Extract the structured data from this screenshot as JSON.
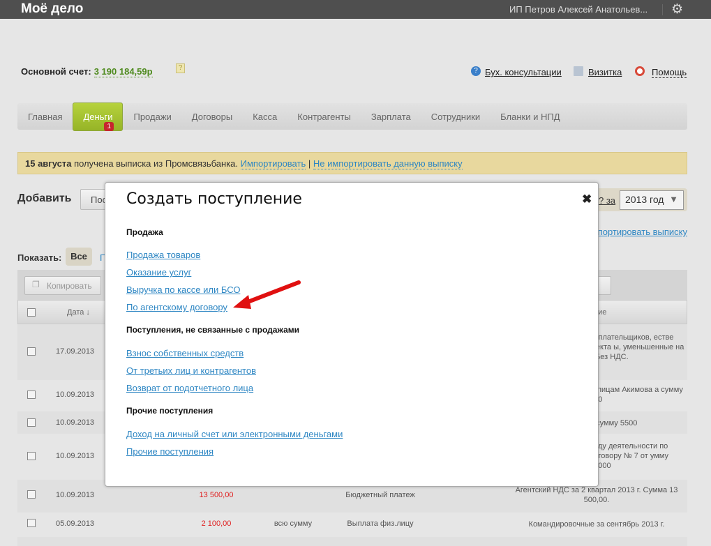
{
  "header": {
    "logo": "Моё дело",
    "user": "ИП Петров Алексей Анатольев...",
    "settings_icon": "gear-icon"
  },
  "account": {
    "label": "Основной счет:",
    "value": "3 190 184,59р",
    "help": "?"
  },
  "top_links": [
    {
      "label": "Бух. консультации",
      "icon": "question-icon"
    },
    {
      "label": "Визитка",
      "icon": "card-icon"
    },
    {
      "label": "Помощь",
      "icon": "lifebuoy-icon"
    }
  ],
  "nav": {
    "tabs": [
      "Главная",
      "Деньги",
      "Продажи",
      "Договоры",
      "Касса",
      "Контрагенты",
      "Зарплата",
      "Сотрудники",
      "Бланки и НПД"
    ],
    "active": "Деньги",
    "badge": "1"
  },
  "notice": {
    "date": "15 августа",
    "text": " получена выписка из Промсвязьбанка. ",
    "import": "Импортировать",
    "sep": " | ",
    "skip": "Не импортировать данную выписку"
  },
  "toolbar": {
    "add_label": "Добавить",
    "add_button": "Пос",
    "period_link": "? за",
    "year": "2013 год",
    "import_link": "Импортировать выписку"
  },
  "filter": {
    "label": "Показать:",
    "all": "Все",
    "other": "П"
  },
  "table": {
    "copy": "Копировать",
    "btn2": "а",
    "col_date": "Дата ↓",
    "col_desc": "ние",
    "rows": [
      {
        "date": "17.09.2013",
        "sum": "",
        "part": "",
        "type": "",
        "desc": "логоплательщиков, естве объекта ы, уменьшенные на ов. Без НДС."
      },
      {
        "date": "10.09.2013",
        "sum": "",
        "part": "",
        "type": "",
        "desc": "м лицам Акимова а сумму 500"
      },
      {
        "date": "10.09.2013",
        "sum": "",
        "part": "",
        "type": "",
        "desc": "а сумму 5500"
      },
      {
        "date": "10.09.2013",
        "sum": "",
        "part": "",
        "type": "",
        "desc": "виду деятельности по договору № 7 от умму 14000"
      },
      {
        "date": "10.09.2013",
        "sum": "13 500,00",
        "part": "",
        "type": "Бюджетный платеж",
        "desc": "Агентский НДС за 2 квартал 2013 г. Сумма 13 500,00."
      },
      {
        "date": "05.09.2013",
        "sum": "2 100,00",
        "part": "всю сумму",
        "type": "Выплата физ.лицу",
        "desc": "Командировочные за сентябрь 2013 г."
      }
    ]
  },
  "modal": {
    "title": "Создать поступление",
    "sections": [
      {
        "title": "Продажа",
        "links": [
          "Продажа товаров",
          "Оказание услуг",
          "Выручка по кассе или БСО",
          "По агентскому договору"
        ]
      },
      {
        "title": "Поступления, не связанные с продажами",
        "links": [
          "Взнос собственных средств",
          "От третьих лиц и контрагентов",
          "Возврат от подотчетного лица"
        ]
      },
      {
        "title": "Прочие поступления",
        "links": [
          "Доход на личный счет или электронными деньгами",
          "Прочие поступления"
        ]
      }
    ]
  },
  "colors": {
    "accent": "#2d86c3",
    "active_tab": "#a6c332",
    "amount_red": "#e02020",
    "balance_green": "#4e8a1e"
  }
}
